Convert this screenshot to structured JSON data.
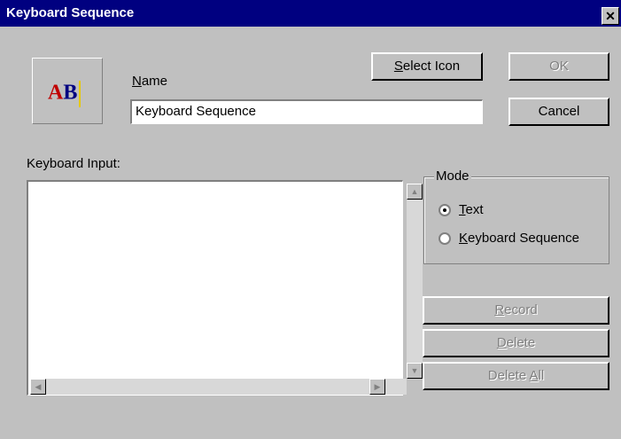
{
  "window": {
    "title": "Keyboard Sequence",
    "close_glyph": "✕"
  },
  "icon_preview": {
    "glyph_a": "A",
    "glyph_b": "B",
    "icon": "keyboard-sequence-ab-icon"
  },
  "name": {
    "label": "Name",
    "value": "Keyboard Sequence"
  },
  "buttons": {
    "select_icon": "Select Icon",
    "ok": "OK",
    "cancel": "Cancel",
    "record": "Record",
    "delete": "Delete",
    "delete_all": "Delete All"
  },
  "keyboard_input": {
    "label": "Keyboard Input:",
    "value": ""
  },
  "mode": {
    "label": "Mode",
    "options": [
      {
        "label": "Text",
        "checked": true
      },
      {
        "label": "Keyboard Sequence",
        "checked": false
      }
    ]
  },
  "colors": {
    "titlebar": "#000080",
    "face": "#c0c0c0",
    "disabled_text": "#808080"
  }
}
